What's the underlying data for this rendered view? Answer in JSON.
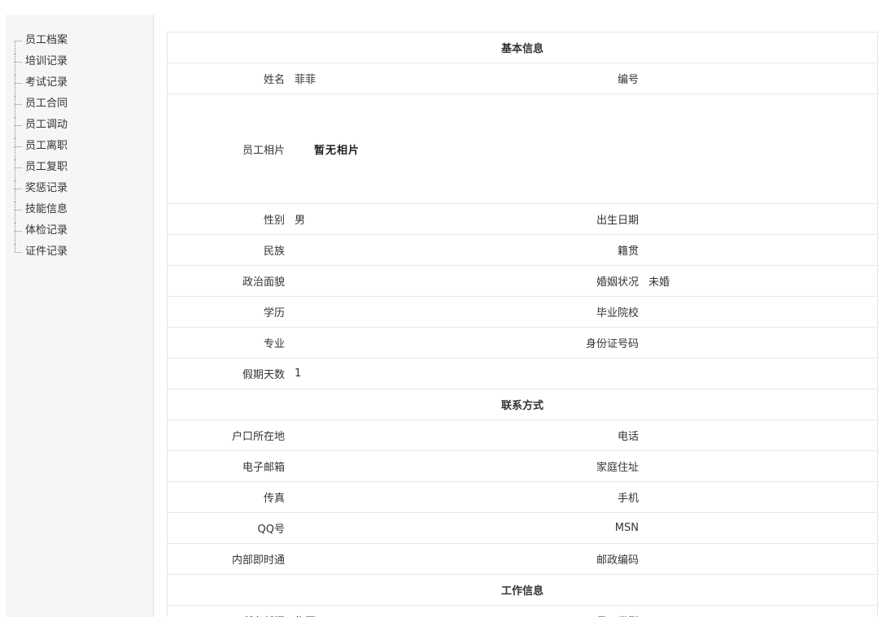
{
  "sidebar": {
    "items": [
      {
        "label": "员工档案"
      },
      {
        "label": "培训记录"
      },
      {
        "label": "考试记录"
      },
      {
        "label": "员工合同"
      },
      {
        "label": "员工调动"
      },
      {
        "label": "员工离职"
      },
      {
        "label": "员工复职"
      },
      {
        "label": "奖惩记录"
      },
      {
        "label": "技能信息"
      },
      {
        "label": "体检记录"
      },
      {
        "label": "证件记录"
      }
    ]
  },
  "basic": {
    "title": "基本信息",
    "name_label": "姓名",
    "name_value": "菲菲",
    "number_label": "编号",
    "number_value": "",
    "photo_label": "员工相片",
    "photo_value": "暂无相片",
    "gender_label": "性别",
    "gender_value": "男",
    "birth_label": "出生日期",
    "birth_value": "",
    "ethnic_label": "民族",
    "ethnic_value": "",
    "native_label": "籍贯",
    "native_value": "",
    "politics_label": "政治面貌",
    "politics_value": "",
    "marital_label": "婚姻状况",
    "marital_value": "未婚",
    "education_label": "学历",
    "education_value": "",
    "school_label": "毕业院校",
    "school_value": "",
    "major_label": "专业",
    "major_value": "",
    "idcard_label": "身份证号码",
    "idcard_value": "",
    "holiday_label": "假期天数",
    "holiday_value": "1"
  },
  "contact": {
    "title": "联系方式",
    "hukou_label": "户口所在地",
    "hukou_value": "",
    "phone_label": "电话",
    "phone_value": "",
    "email_label": "电子邮箱",
    "email_value": "",
    "address_label": "家庭住址",
    "address_value": "",
    "fax_label": "传真",
    "fax_value": "",
    "mobile_label": "手机",
    "mobile_value": "",
    "qq_label": "QQ号",
    "qq_value": "",
    "msn_label": "MSN",
    "msn_value": "",
    "im_label": "内部即时通",
    "im_value": "",
    "zip_label": "邮政编码",
    "zip_value": ""
  },
  "work": {
    "title": "工作信息",
    "dept_label": "所在部门",
    "dept_value": "集团",
    "type_label": "员工类型",
    "type_value": ""
  }
}
